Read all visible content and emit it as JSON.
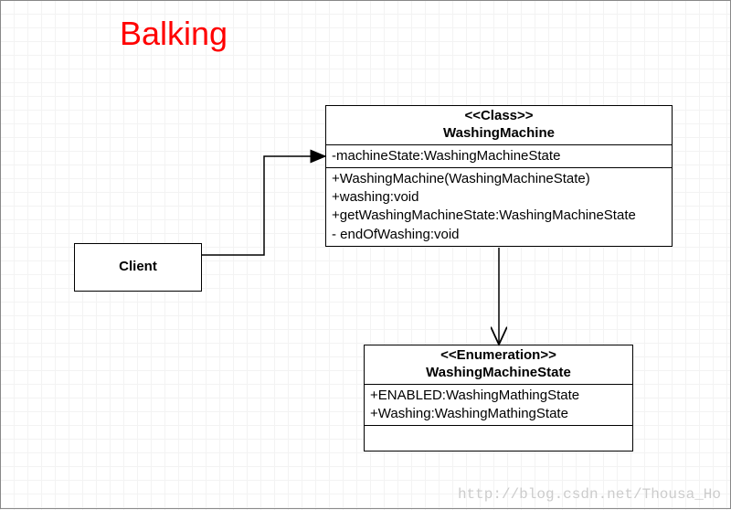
{
  "title": "Balking",
  "client": {
    "name": "Client"
  },
  "washingMachine": {
    "stereotype": "<<Class>>",
    "name": "WashingMachine",
    "attributes": [
      "-machineState:WashingMachineState"
    ],
    "operations": [
      "+WashingMachine(WashingMachineState)",
      "+washing:void",
      "+getWashingMachineState:WashingMachineState",
      "- endOfWashing:void"
    ]
  },
  "washingMachineState": {
    "stereotype": "<<Enumeration>>",
    "name": "WashingMachineState",
    "values": [
      "+ENABLED:WashingMathingState",
      "+Washing:WashingMathingState"
    ]
  },
  "watermark": "http://blog.csdn.net/Thousa_Ho"
}
